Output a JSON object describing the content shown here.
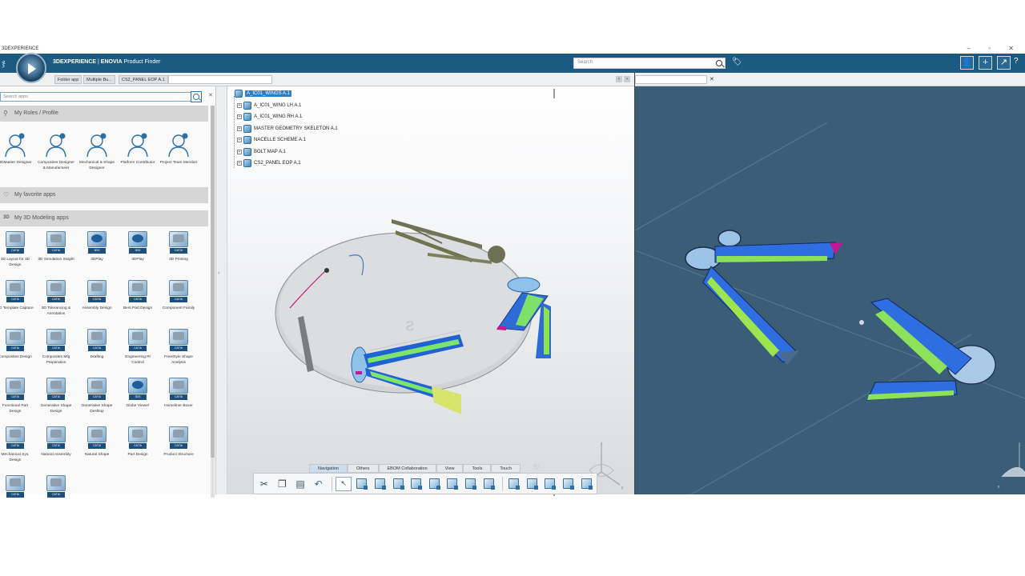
{
  "window": {
    "title": "3DEXPERIENCE",
    "controls": [
      "–",
      "□",
      "✕"
    ]
  },
  "topbar": {
    "brand_prefix": "3DEXPERIENCE",
    "brand_sep": " | ",
    "brand_app": "ENOVIA",
    "brand_suffix": " Product Finder",
    "search_placeholder": "Search",
    "buttons": [
      "user-icon",
      "add-icon",
      "share-icon",
      "help-icon"
    ],
    "accent_color": "#1c5a82"
  },
  "tabs": {
    "items": [
      {
        "label": "Folder app"
      },
      {
        "label": "Multiple Bu..."
      },
      {
        "label": "CS2_PANEL EOP A.1"
      }
    ]
  },
  "left_panel": {
    "search_placeholder": "Search apps",
    "sections": {
      "roles": "My Roles / Profile",
      "favorites": "My favorite apps",
      "modeling": "My 3D Modeling apps",
      "modeling_prefix": "3D"
    },
    "roles": [
      {
        "label": "3DMaster Designer"
      },
      {
        "label": "Composites Designer & Manufacturer"
      },
      {
        "label": "Mechanical & Shape Designer"
      },
      {
        "label": "Platform Contributor"
      },
      {
        "label": "Project Team Member"
      }
    ],
    "apps": [
      {
        "label": "3D Layout for 3D Design",
        "badge": "CATIA"
      },
      {
        "label": "3D Simulation Insight",
        "badge": "CATIA"
      },
      {
        "label": "3DPlay",
        "badge": "3DS"
      },
      {
        "label": "3DPlay",
        "badge": "3DS"
      },
      {
        "label": "3D Printing",
        "badge": "CATIA"
      },
      {
        "label": "3D Template Capture",
        "badge": "CATIA"
      },
      {
        "label": "3D Tolerancing & Annotation",
        "badge": "CATIA"
      },
      {
        "label": "Assembly Design",
        "badge": "CATIA"
      },
      {
        "label": "Bent Part Design",
        "badge": "CATIA"
      },
      {
        "label": "Component Family",
        "badge": "CATIA"
      },
      {
        "label": "Composites Design",
        "badge": "CATIA"
      },
      {
        "label": "Composites Mfg Preparation",
        "badge": "CATIA"
      },
      {
        "label": "Drafting",
        "badge": "CATIA"
      },
      {
        "label": "Engineering Rl Control",
        "badge": "CATIA"
      },
      {
        "label": "FreeStyle Shape Analysis",
        "badge": "CATIA"
      },
      {
        "label": "Functional Part Design",
        "badge": "CATIA"
      },
      {
        "label": "Generative Shape Design",
        "badge": "CATIA"
      },
      {
        "label": "Generative Shape Desktop",
        "badge": "CATIA"
      },
      {
        "label": "Globe Viewer",
        "badge": "3DS"
      },
      {
        "label": "Homeliner Boxer",
        "badge": "CATIA"
      },
      {
        "label": "Mechanical Sys. Design",
        "badge": "CATIA"
      },
      {
        "label": "Natural Assembly",
        "badge": "CATIA"
      },
      {
        "label": "Natural Shape",
        "badge": "CATIA"
      },
      {
        "label": "Part Design",
        "badge": "CATIA"
      },
      {
        "label": "Product Structure",
        "badge": "CATIA"
      },
      {
        "label": "",
        "badge": "CATIA"
      },
      {
        "label": "",
        "badge": "CATIA"
      }
    ]
  },
  "tree": {
    "items": [
      {
        "label": "A_IC01_WINGS A.1",
        "selected": true,
        "level": 0
      },
      {
        "label": "A_IC01_WING LH A.1",
        "level": 1
      },
      {
        "label": "A_IC01_WING RH A.1",
        "level": 1
      },
      {
        "label": "MASTER GEOMETRY SKELETON A.1",
        "level": 1
      },
      {
        "label": "NACELLE SCHEME A.1",
        "level": 1
      },
      {
        "label": "BOLT MAP A.1",
        "level": 1
      },
      {
        "label": "CS2_PANEL EOP A.1",
        "level": 1
      }
    ]
  },
  "actionbar": {
    "tabs": [
      "Navigation",
      "Others",
      "EBOM Collaboration",
      "View",
      "Tools",
      "Touch"
    ],
    "active_tab": "Navigation"
  },
  "viewport": {
    "left_bg": "#e6e7e9",
    "right_bg": "#3a5e78",
    "compass_axes": [
      "x",
      "y",
      "z"
    ]
  }
}
